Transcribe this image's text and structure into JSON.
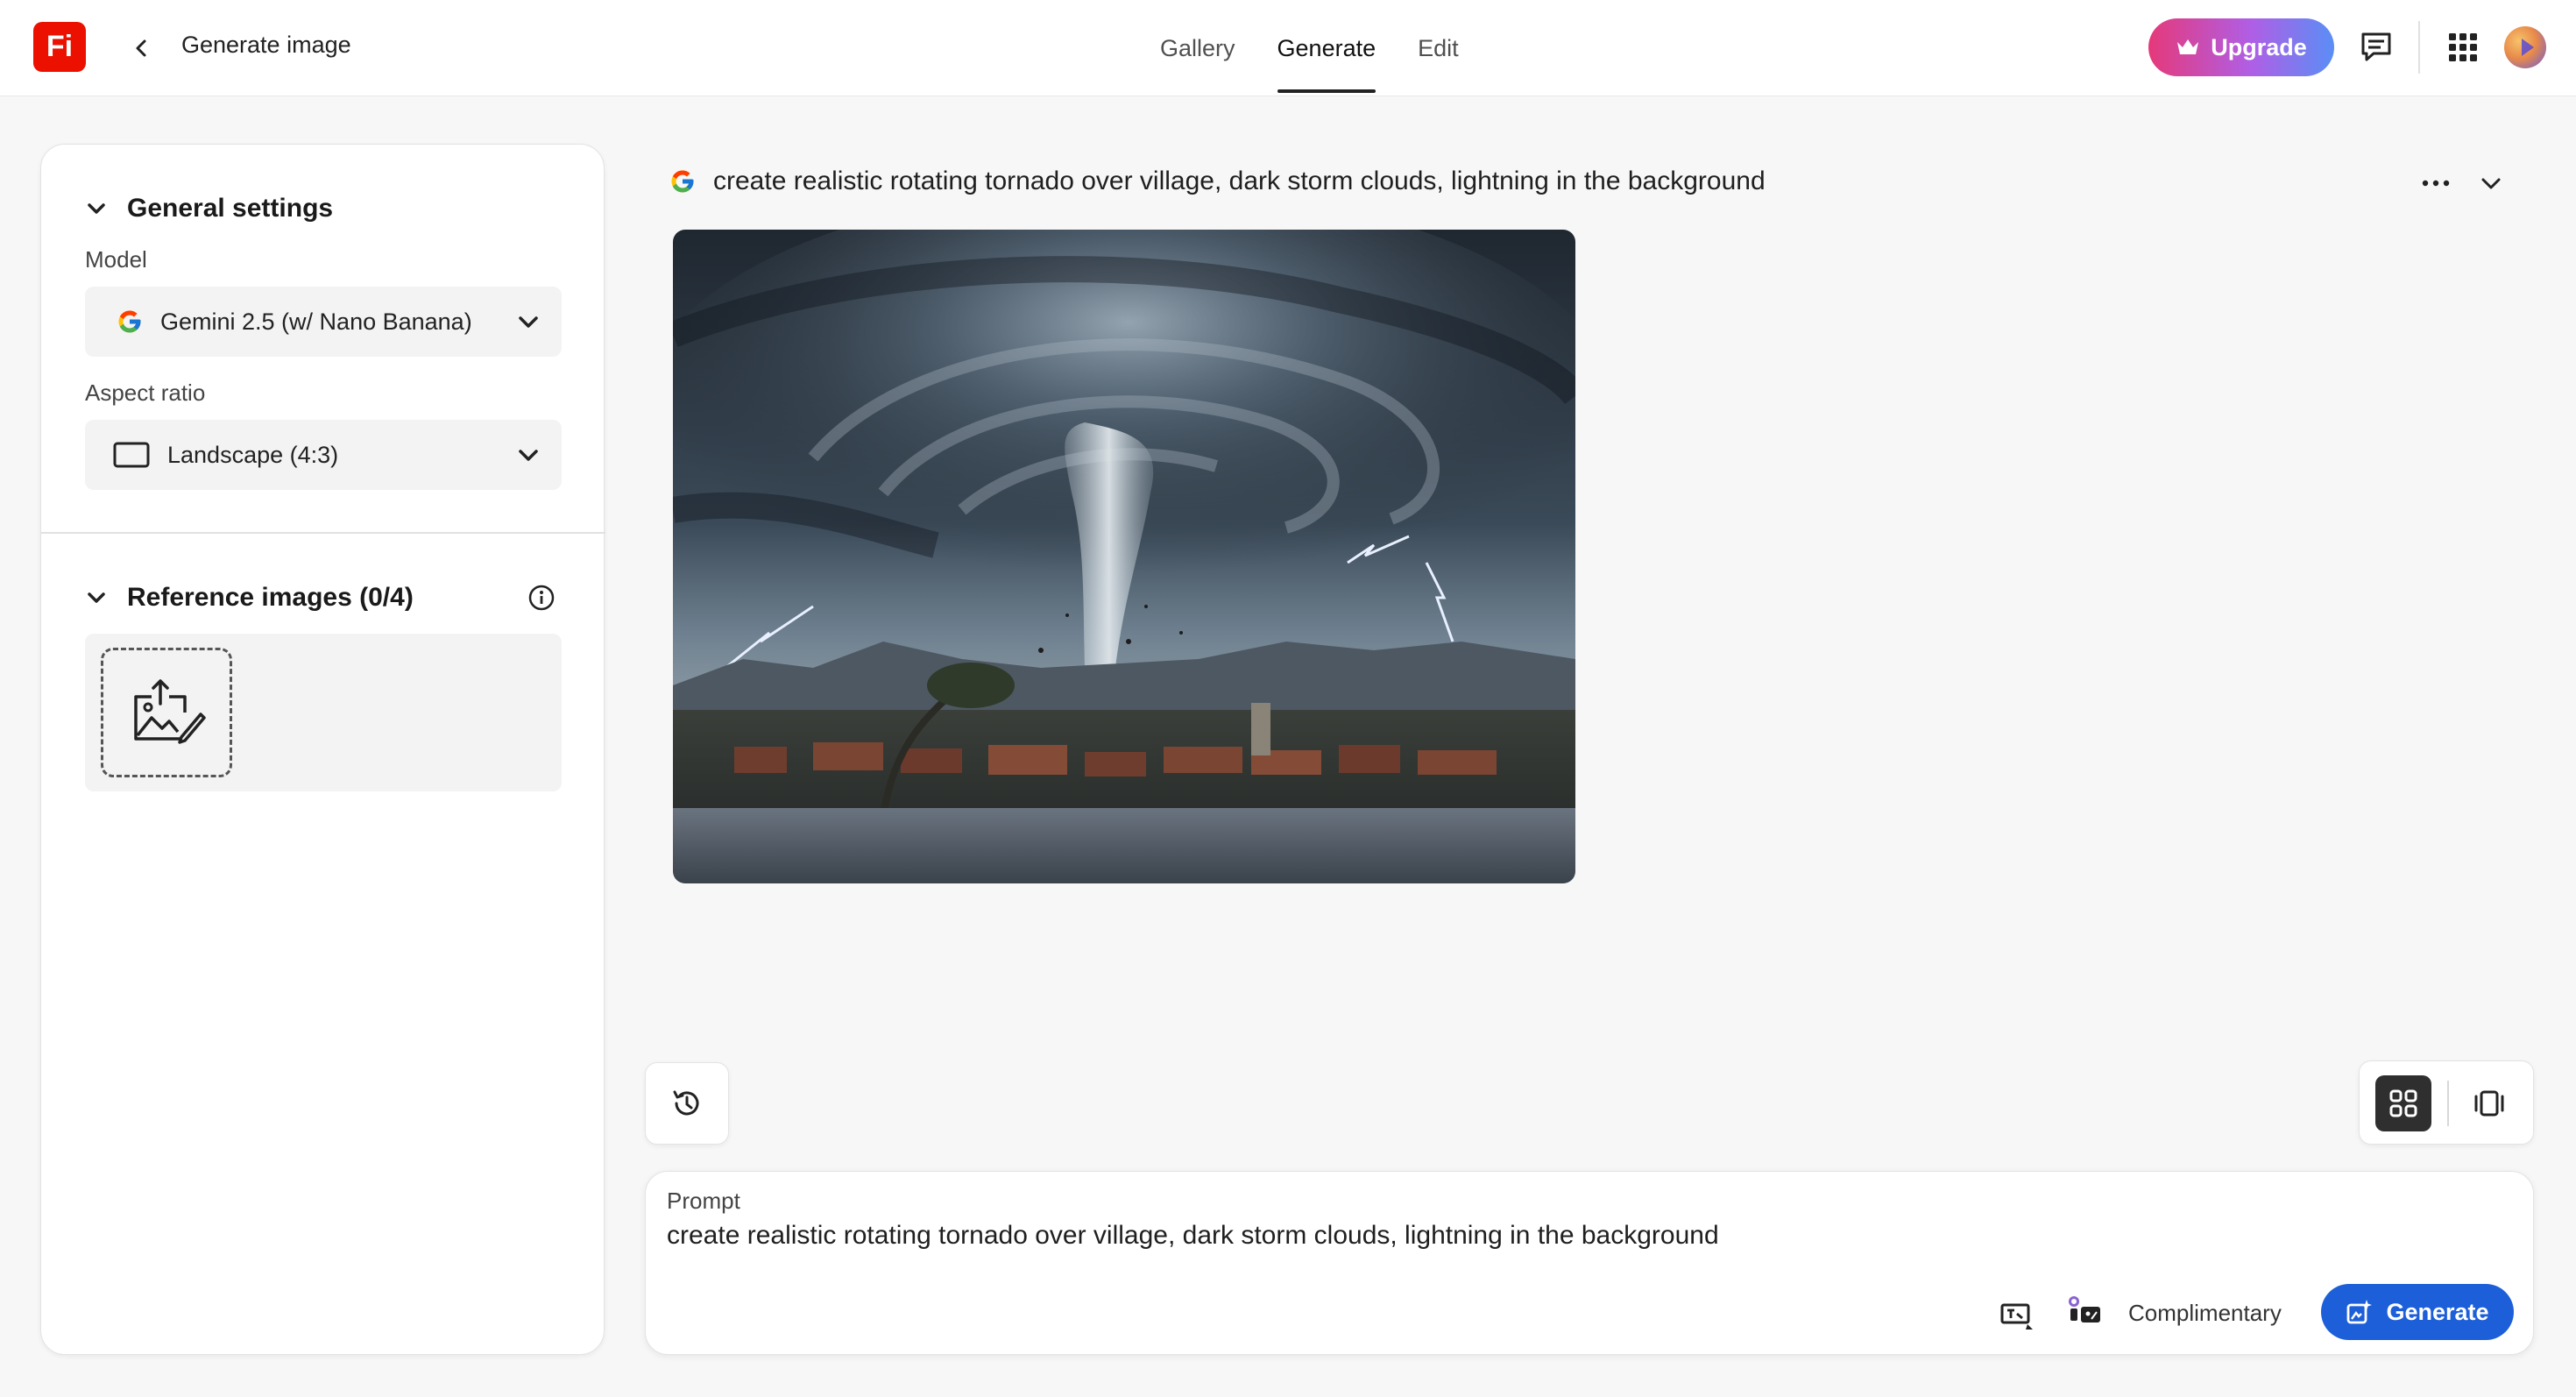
{
  "app": {
    "logo_text": "Fi",
    "page_title": "Generate image"
  },
  "nav": {
    "tabs": [
      {
        "label": "Gallery"
      },
      {
        "label": "Generate",
        "active": true
      },
      {
        "label": "Edit"
      }
    ]
  },
  "header_actions": {
    "upgrade_label": "Upgrade",
    "icons": [
      "comment-icon",
      "apps-grid-icon",
      "avatar"
    ]
  },
  "settings": {
    "general_title": "General settings",
    "model_label": "Model",
    "model_value": "Gemini 2.5 (w/ Nano Banana)",
    "aspect_label": "Aspect ratio",
    "aspect_value": "Landscape (4:3)",
    "reference_title": "Reference images (0/4)"
  },
  "result": {
    "prompt": "create realistic rotating tornado over village, dark storm clouds, lightning in the background"
  },
  "prompt_panel": {
    "label": "Prompt",
    "value": "create realistic rotating tornado over village, dark storm clouds, lightning in the background",
    "credits_label": "Complimentary",
    "generate_label": "Generate"
  },
  "colors": {
    "brand": "#eb1000",
    "primary_button": "#1c5fd9",
    "upgrade_gradient": [
      "#e5397a",
      "#b05ee5",
      "#5a8ef5"
    ]
  }
}
